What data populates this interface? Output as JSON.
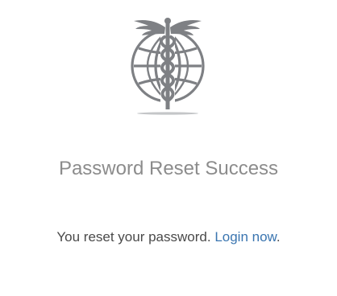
{
  "logo": {
    "icon": "caduceus-globe-icon",
    "color": "#7e8084"
  },
  "title": "Password Reset Success",
  "message": {
    "text": "You reset your password.",
    "link_text": "Login now",
    "trailing": "."
  },
  "colors": {
    "title": "#8c8c8c",
    "text": "#4a4a4a",
    "link": "#3a75b0"
  }
}
